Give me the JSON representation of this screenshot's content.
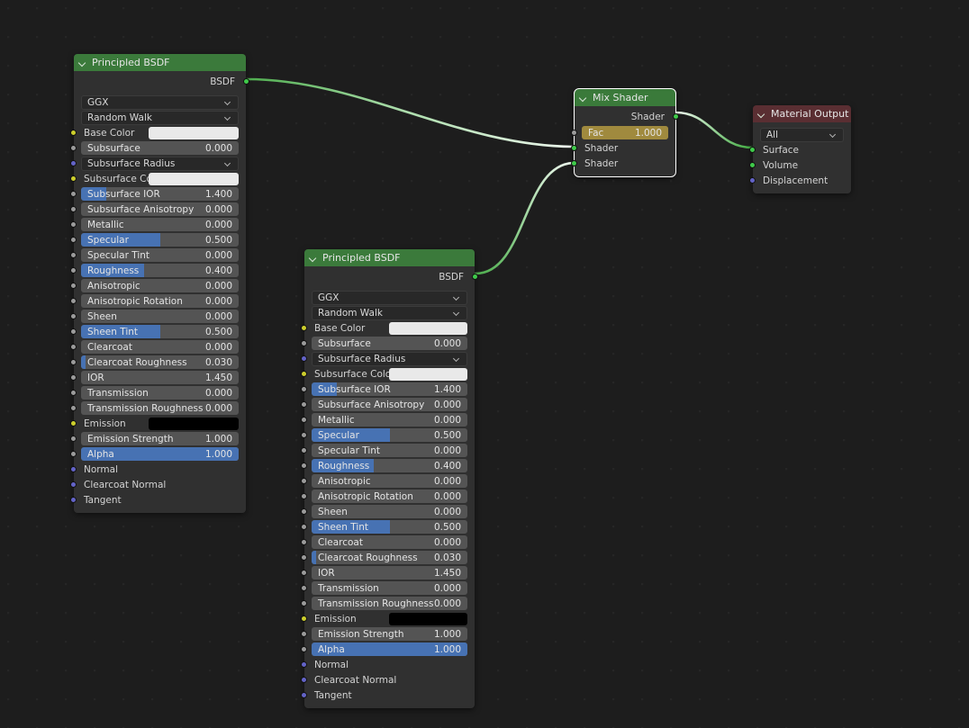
{
  "editor": {
    "background_color": "#1d1d1d",
    "grid_dot_color": "#262626"
  },
  "colors": {
    "header_bsdf": "#3b7a3b",
    "header_output": "#5a2e32",
    "node_body": "#303030",
    "slider_fill": "#4772b3",
    "slider_track": "#545454",
    "fac_fill": "#a08a3e",
    "fac_track": "#6d6233",
    "socket_color": "#ccce2c",
    "socket_value": "#9b9b9b",
    "socket_vector": "#6363c7",
    "socket_shader": "#3fca4a",
    "noodle_shader": "#4aa34a"
  },
  "nodes": [
    {
      "id": "principled-bsdf-1",
      "title": "Principled BSDF",
      "selected": false,
      "outputs": [
        {
          "label": "BSDF",
          "socket": "shader"
        }
      ],
      "distribution": "GGX",
      "subsurface_method": "Random Walk",
      "rows": [
        {
          "type": "color",
          "label": "Base Color",
          "socket": "color",
          "value": "#e9e9e9"
        },
        {
          "type": "slider",
          "label": "Subsurface",
          "socket": "value",
          "value": "0.000",
          "fill": 0
        },
        {
          "type": "dropdown",
          "label": "Subsurface Radius",
          "socket": "vector"
        },
        {
          "type": "color",
          "label": "Subsurface Col…",
          "socket": "color",
          "value": "#e9e9e9"
        },
        {
          "type": "slider",
          "label": "Subsurface IOR",
          "socket": "value",
          "value": "1.400",
          "fill": 16
        },
        {
          "type": "slider",
          "label": "Subsurface Anisotropy",
          "socket": "value",
          "value": "0.000",
          "fill": 0
        },
        {
          "type": "slider",
          "label": "Metallic",
          "socket": "value",
          "value": "0.000",
          "fill": 0
        },
        {
          "type": "slider",
          "label": "Specular",
          "socket": "value",
          "value": "0.500",
          "fill": 50
        },
        {
          "type": "slider",
          "label": "Specular Tint",
          "socket": "value",
          "value": "0.000",
          "fill": 0
        },
        {
          "type": "slider",
          "label": "Roughness",
          "socket": "value",
          "value": "0.400",
          "fill": 40
        },
        {
          "type": "slider",
          "label": "Anisotropic",
          "socket": "value",
          "value": "0.000",
          "fill": 0
        },
        {
          "type": "slider",
          "label": "Anisotropic Rotation",
          "socket": "value",
          "value": "0.000",
          "fill": 0
        },
        {
          "type": "slider",
          "label": "Sheen",
          "socket": "value",
          "value": "0.000",
          "fill": 0
        },
        {
          "type": "slider",
          "label": "Sheen Tint",
          "socket": "value",
          "value": "0.500",
          "fill": 50
        },
        {
          "type": "slider",
          "label": "Clearcoat",
          "socket": "value",
          "value": "0.000",
          "fill": 0
        },
        {
          "type": "slider",
          "label": "Clearcoat Roughness",
          "socket": "value",
          "value": "0.030",
          "fill": 3
        },
        {
          "type": "slider",
          "label": "IOR",
          "socket": "value",
          "value": "1.450",
          "fill": 0
        },
        {
          "type": "slider",
          "label": "Transmission",
          "socket": "value",
          "value": "0.000",
          "fill": 0
        },
        {
          "type": "slider",
          "label": "Transmission Roughness",
          "socket": "value",
          "value": "0.000",
          "fill": 0
        },
        {
          "type": "color",
          "label": "Emission",
          "socket": "color",
          "value": "#000000"
        },
        {
          "type": "slider",
          "label": "Emission Strength",
          "socket": "value",
          "value": "1.000",
          "fill": 0
        },
        {
          "type": "slider",
          "label": "Alpha",
          "socket": "value",
          "value": "1.000",
          "fill": 100
        },
        {
          "type": "plain",
          "label": "Normal",
          "socket": "vector"
        },
        {
          "type": "plain",
          "label": "Clearcoat Normal",
          "socket": "vector"
        },
        {
          "type": "plain",
          "label": "Tangent",
          "socket": "vector"
        }
      ]
    },
    {
      "id": "principled-bsdf-2",
      "title": "Principled BSDF",
      "selected": false,
      "outputs": [
        {
          "label": "BSDF",
          "socket": "shader"
        }
      ],
      "distribution": "GGX",
      "subsurface_method": "Random Walk",
      "rows": [
        {
          "type": "color",
          "label": "Base Color",
          "socket": "color",
          "value": "#e9e9e9"
        },
        {
          "type": "slider",
          "label": "Subsurface",
          "socket": "value",
          "value": "0.000",
          "fill": 0
        },
        {
          "type": "dropdown",
          "label": "Subsurface Radius",
          "socket": "vector"
        },
        {
          "type": "color",
          "label": "Subsurface Colo",
          "socket": "color",
          "value": "#e9e9e9"
        },
        {
          "type": "slider",
          "label": "Subsurface IOR",
          "socket": "value",
          "value": "1.400",
          "fill": 16
        },
        {
          "type": "slider",
          "label": "Subsurface Anisotropy",
          "socket": "value",
          "value": "0.000",
          "fill": 0
        },
        {
          "type": "slider",
          "label": "Metallic",
          "socket": "value",
          "value": "0.000",
          "fill": 0
        },
        {
          "type": "slider",
          "label": "Specular",
          "socket": "value",
          "value": "0.500",
          "fill": 50
        },
        {
          "type": "slider",
          "label": "Specular Tint",
          "socket": "value",
          "value": "0.000",
          "fill": 0
        },
        {
          "type": "slider",
          "label": "Roughness",
          "socket": "value",
          "value": "0.400",
          "fill": 40
        },
        {
          "type": "slider",
          "label": "Anisotropic",
          "socket": "value",
          "value": "0.000",
          "fill": 0
        },
        {
          "type": "slider",
          "label": "Anisotropic Rotation",
          "socket": "value",
          "value": "0.000",
          "fill": 0
        },
        {
          "type": "slider",
          "label": "Sheen",
          "socket": "value",
          "value": "0.000",
          "fill": 0
        },
        {
          "type": "slider",
          "label": "Sheen Tint",
          "socket": "value",
          "value": "0.500",
          "fill": 50
        },
        {
          "type": "slider",
          "label": "Clearcoat",
          "socket": "value",
          "value": "0.000",
          "fill": 0
        },
        {
          "type": "slider",
          "label": "Clearcoat Roughness",
          "socket": "value",
          "value": "0.030",
          "fill": 3
        },
        {
          "type": "slider",
          "label": "IOR",
          "socket": "value",
          "value": "1.450",
          "fill": 0
        },
        {
          "type": "slider",
          "label": "Transmission",
          "socket": "value",
          "value": "0.000",
          "fill": 0
        },
        {
          "type": "slider",
          "label": "Transmission Roughness",
          "socket": "value",
          "value": "0.000",
          "fill": 0
        },
        {
          "type": "color",
          "label": "Emission",
          "socket": "color",
          "value": "#000000"
        },
        {
          "type": "slider",
          "label": "Emission Strength",
          "socket": "value",
          "value": "1.000",
          "fill": 0
        },
        {
          "type": "slider",
          "label": "Alpha",
          "socket": "value",
          "value": "1.000",
          "fill": 100
        },
        {
          "type": "plain",
          "label": "Normal",
          "socket": "vector"
        },
        {
          "type": "plain",
          "label": "Clearcoat Normal",
          "socket": "vector"
        },
        {
          "type": "plain",
          "label": "Tangent",
          "socket": "vector"
        }
      ]
    },
    {
      "id": "mix-shader",
      "title": "Mix Shader",
      "selected": true,
      "outputs": [
        {
          "label": "Shader",
          "socket": "shader"
        }
      ],
      "rows": [
        {
          "type": "slider",
          "label": "Fac",
          "socket": "value",
          "value": "1.000",
          "fill": 100,
          "style": "gold"
        },
        {
          "type": "plain",
          "label": "Shader",
          "socket": "shader"
        },
        {
          "type": "plain",
          "label": "Shader",
          "socket": "shader"
        }
      ]
    },
    {
      "id": "material-output",
      "title": "Material Output",
      "selected": false,
      "target": "All",
      "rows": [
        {
          "type": "plain",
          "label": "Surface",
          "socket": "shader"
        },
        {
          "type": "plain",
          "label": "Volume",
          "socket": "shader"
        },
        {
          "type": "plain",
          "label": "Displacement",
          "socket": "vector"
        }
      ]
    }
  ],
  "links": [
    {
      "from": "principled-bsdf-1.BSDF",
      "to": "mix-shader.Shader-1"
    },
    {
      "from": "principled-bsdf-2.BSDF",
      "to": "mix-shader.Shader-2"
    },
    {
      "from": "mix-shader.Shader",
      "to": "material-output.Surface"
    }
  ]
}
